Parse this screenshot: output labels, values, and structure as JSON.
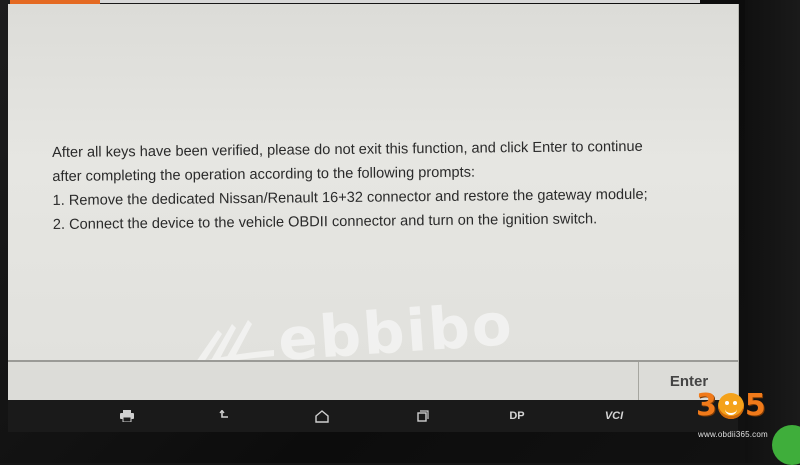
{
  "dialog": {
    "message_lines": [
      "After all keys have been verified,  please do not exit this function,  and click Enter to continue",
      "after completing the operation according to the following prompts:",
      "1. Remove the dedicated Nissan/Renault 16+32 connector and restore the gateway module;",
      "2. Connect the device to the vehicle OBDII connector and turn on the ignition switch."
    ],
    "enter_label": "Enter"
  },
  "watermark": {
    "text": "ebbibo"
  },
  "navbar": {
    "items": [
      {
        "name": "print",
        "icon": "printer-icon"
      },
      {
        "name": "back",
        "icon": "back-arrow-icon"
      },
      {
        "name": "home",
        "icon": "home-icon"
      },
      {
        "name": "recent",
        "icon": "recent-apps-icon"
      },
      {
        "name": "dp",
        "label": "DP"
      },
      {
        "name": "vci",
        "label": "VCI"
      }
    ]
  },
  "brand": {
    "digit_left": "3",
    "digit_right": "5",
    "url": "www.obdii365.com"
  },
  "colors": {
    "screen_bg": "#e0e0dc",
    "text": "#2a2a2a",
    "navbar_bg": "#1a1a1a",
    "brand_orange": "#f07a1a",
    "status_orange": "#e46a22"
  }
}
